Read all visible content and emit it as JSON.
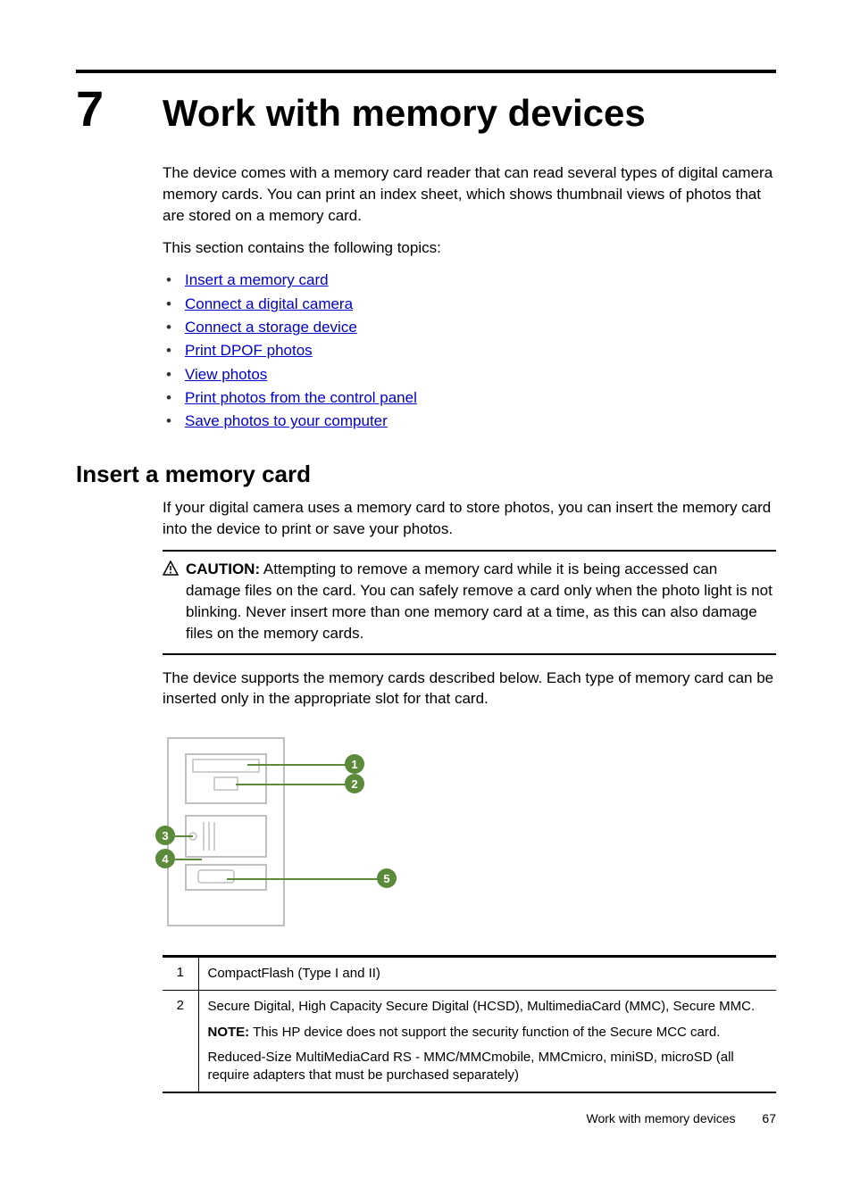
{
  "chapter": {
    "number": "7",
    "title": "Work with memory devices"
  },
  "intro": "The device comes with a memory card reader that can read several types of digital camera memory cards. You can print an index sheet, which shows thumbnail views of photos that are stored on a memory card.",
  "topics_intro": "This section contains the following topics:",
  "topics": [
    "Insert a memory card",
    "Connect a digital camera",
    "Connect a storage device",
    "Print DPOF photos",
    "View photos",
    "Print photos from the control panel",
    "Save photos to your computer"
  ],
  "section": {
    "heading": "Insert a memory card",
    "p1": "If your digital camera uses a memory card to store photos, you can insert the memory card into the device to print or save your photos.",
    "caution_label": "CAUTION:",
    "caution_text": "Attempting to remove a memory card while it is being accessed can damage files on the card. You can safely remove a card only when the photo light is not blinking. Never insert more than one memory card at a time, as this can also damage files on the memory cards.",
    "p2": "The device supports the memory cards described below. Each type of memory card can be inserted only in the appropriate slot for that card."
  },
  "diagram_callouts": [
    "1",
    "2",
    "3",
    "4",
    "5"
  ],
  "table": {
    "rows": [
      {
        "num": "1",
        "cells": [
          "CompactFlash (Type I and II)"
        ]
      },
      {
        "num": "2",
        "cells": [
          "Secure Digital, High Capacity Secure Digital (HCSD), MultimediaCard (MMC), Secure MMC.",
          {
            "note_label": "NOTE:",
            "note_text": "This HP device does not support the security function of the Secure MCC card."
          },
          "Reduced-Size MultiMediaCard RS - MMC/MMCmobile, MMCmicro, miniSD, microSD (all require adapters that must be purchased separately)"
        ]
      }
    ]
  },
  "footer": {
    "title": "Work with memory devices",
    "page": "67"
  }
}
